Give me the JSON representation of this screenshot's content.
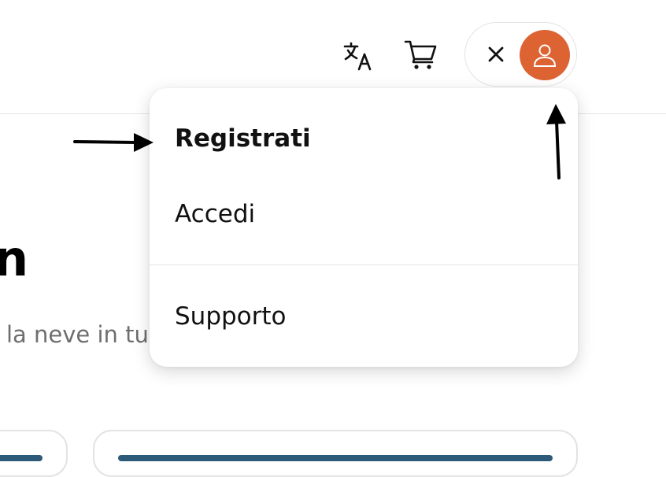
{
  "header": {
    "translate_icon": "translate-icon",
    "cart_icon": "cart-icon",
    "close_icon": "close-icon",
    "user_icon": "user-icon",
    "avatar_color": "#dd6333"
  },
  "background": {
    "heading_fragment": "n",
    "subtitle_fragment": "la neve in tu"
  },
  "user_menu": {
    "items": [
      {
        "label": "Registrati"
      },
      {
        "label": "Accedi"
      },
      {
        "label": "Supporto"
      }
    ]
  }
}
